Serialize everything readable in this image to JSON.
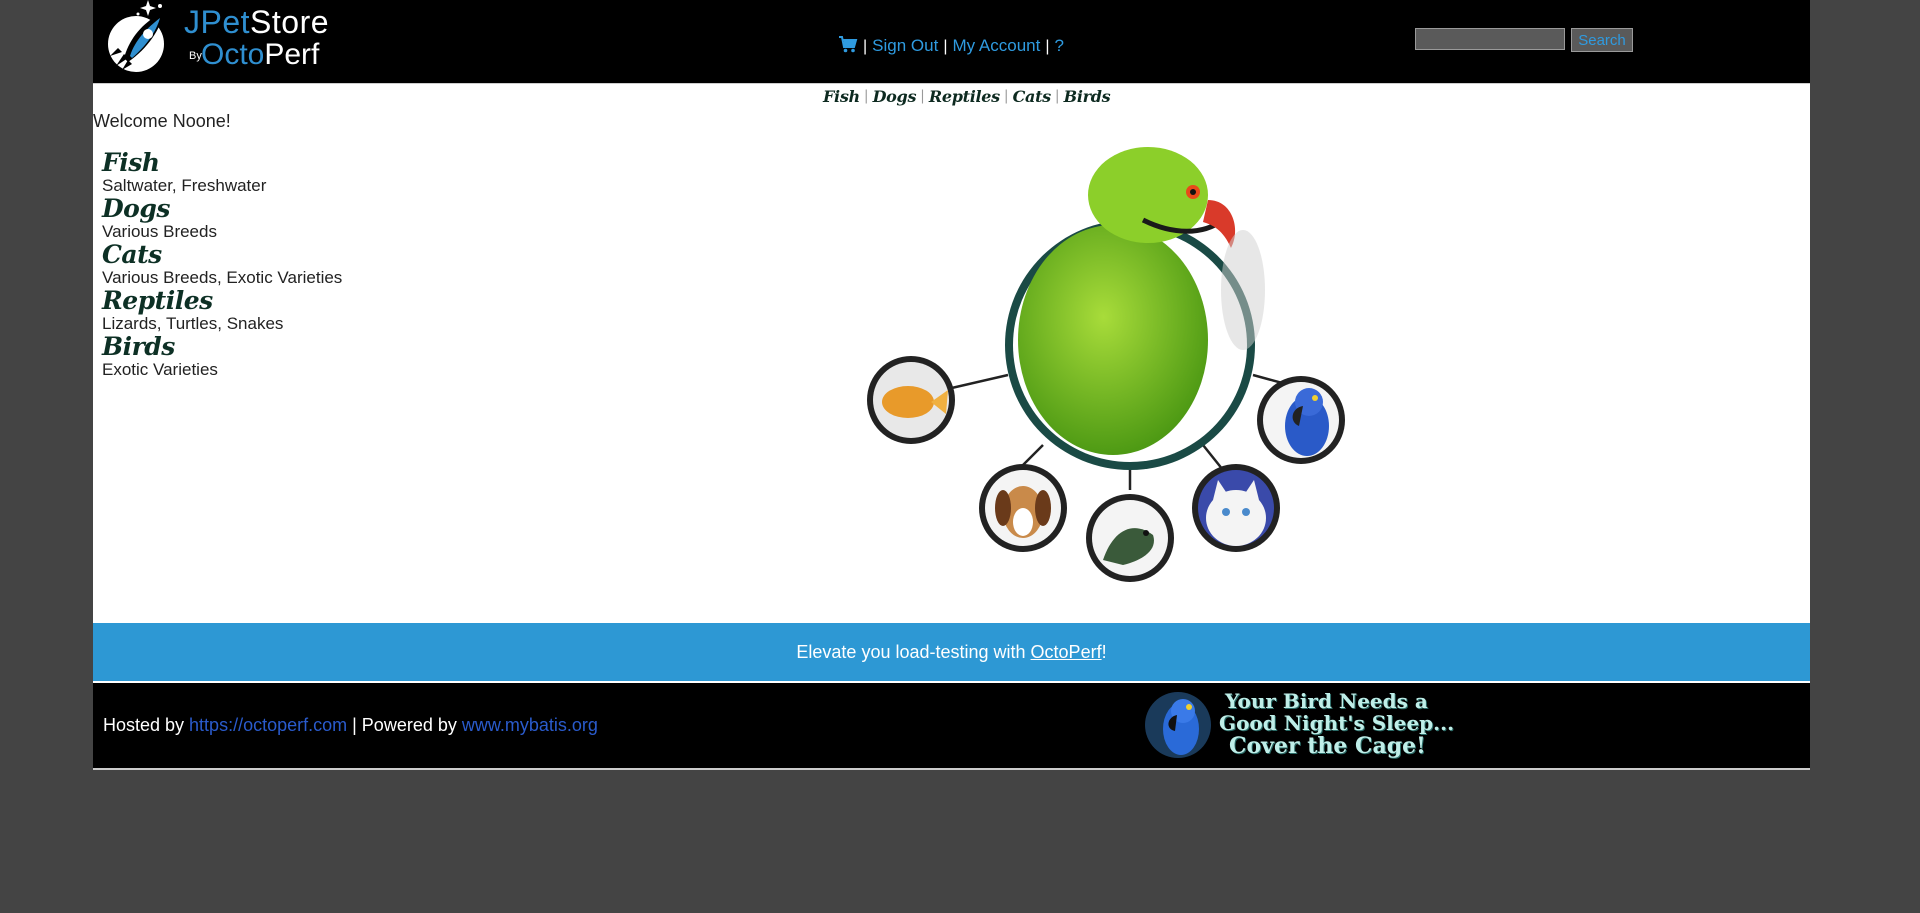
{
  "header": {
    "logo": {
      "word1": "JPet",
      "word2": "Store",
      "by": "By",
      "brand1": "Octo",
      "brand2": "Perf"
    },
    "menu": {
      "cart_icon": "cart-icon",
      "separator": "|",
      "sign_out": "Sign Out",
      "my_account": "My Account",
      "help": "?"
    },
    "search": {
      "value": "",
      "placeholder": "",
      "button_label": "Search"
    }
  },
  "quicklinks": [
    "Fish",
    "Dogs",
    "Reptiles",
    "Cats",
    "Birds"
  ],
  "welcome": "Welcome Noone!",
  "sidebar": {
    "items": [
      {
        "title": "Fish",
        "desc": "Saltwater, Freshwater"
      },
      {
        "title": "Dogs",
        "desc": "Various Breeds"
      },
      {
        "title": "Cats",
        "desc": "Various Breeds, Exotic Varieties"
      },
      {
        "title": "Reptiles",
        "desc": "Lizards, Turtles, Snakes"
      },
      {
        "title": "Birds",
        "desc": "Exotic Varieties"
      }
    ]
  },
  "main_image": {
    "center": "parrot",
    "satellites": [
      "goldfish",
      "dog",
      "reptile",
      "cat",
      "macaw"
    ]
  },
  "promo": {
    "text_before": "Elevate you load-testing with ",
    "link": "OctoPerf",
    "text_after": "!"
  },
  "footer": {
    "hosted_by": "Hosted by ",
    "hosted_link": "https://octoperf.com",
    "powered_by": " | Powered by ",
    "powered_link": "www.mybatis.org",
    "banner": [
      "Your Bird Needs a",
      "Good Night's Sleep...",
      "Cover the Cage!"
    ]
  },
  "colors": {
    "page_bg": "#444444",
    "header_bg": "#000000",
    "link_blue": "#2f9be0",
    "promo_bg": "#2d98d4",
    "category_green": "#0d3025"
  }
}
